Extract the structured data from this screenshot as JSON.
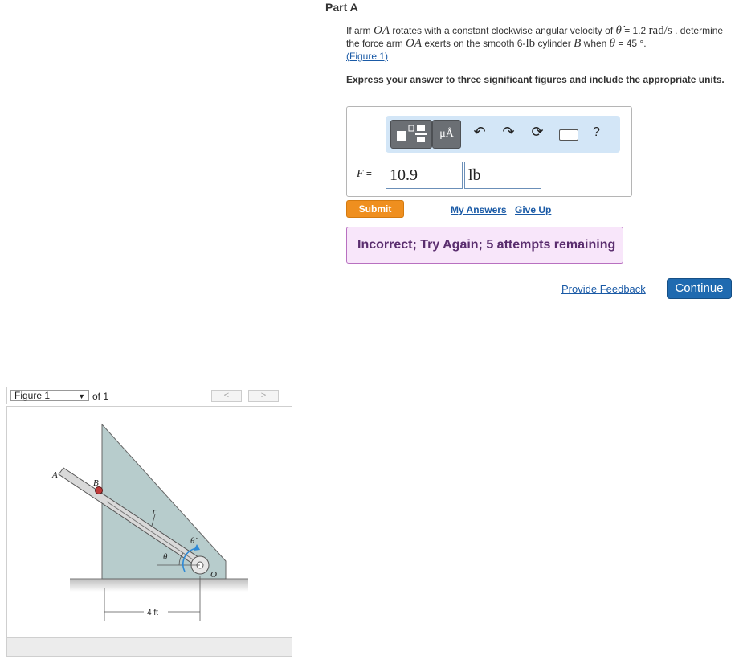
{
  "figure_panel": {
    "selected_figure": "Figure 1",
    "of_label": "of 1",
    "prev_label": "<",
    "next_label": ">",
    "diagram": {
      "label_A": "A",
      "label_B": "B",
      "label_r": "r",
      "label_theta": "θ",
      "label_theta_dot": "θ̇",
      "label_O": "O",
      "dimension": "4 ft",
      "colors": {
        "wedge": "#b7cccc",
        "arm": "#d9d9d9",
        "ground": "#c8c8c8",
        "cylinder": "#c03a3a",
        "omega_arrow": "#2f8ad6"
      }
    }
  },
  "part": {
    "title": "Part A"
  },
  "question": {
    "t1": "If arm ",
    "m1": "OA",
    "t2": " rotates with a constant clockwise angular velocity of ",
    "m2": "θ̇",
    "t3": " = 1.2 ",
    "u1": "rad/s",
    "t4": " . determine the force arm ",
    "m3": "OA",
    "t5": " exerts on the smooth 6-",
    "u2": "lb",
    "t6": " cylinder ",
    "m4": "B",
    "t7": " when ",
    "m5": "θ",
    "t8": " = 45 °.",
    "figure_link": "(Figure 1)"
  },
  "instruction": "Express your answer to three significant figures and include the appropriate units.",
  "toolbar": {
    "units_label": "μÅ",
    "undo_icon": "undo-icon",
    "redo_icon": "redo-icon",
    "reset_icon": "reset-icon",
    "keyboard_icon": "keyboard-icon",
    "help_label": "?"
  },
  "answer": {
    "variable": "F",
    "equals": " =",
    "value": "10.9",
    "unit": "lb"
  },
  "actions": {
    "submit": "Submit",
    "my_answers": "My Answers",
    "give_up": "Give Up"
  },
  "feedback": {
    "message": "Incorrect; Try Again; 5 attempts remaining",
    "colors": {
      "background": "#f8e6fa",
      "border": "#b870c0",
      "text": "#5a2d6e"
    }
  },
  "footer": {
    "provide_feedback": "Provide Feedback",
    "continue": "Continue"
  },
  "colors": {
    "submit": "#ef8f1f",
    "continue": "#1f6ab0",
    "link": "#1a5aa6",
    "toolbar": "#d3e6f7"
  }
}
